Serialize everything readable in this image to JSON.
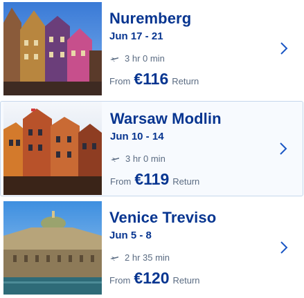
{
  "colors": {
    "accent": "#073590",
    "muted_text": "#5a6b82",
    "chevron": "#1a56c4",
    "selected_border": "#c6d7ec"
  },
  "destinations": [
    {
      "city": "Nuremberg",
      "dates": "Jun 17 - 21",
      "duration": "3 hr 0 min",
      "from_label": "From",
      "price": "€116",
      "trip_type": "Return",
      "icon": "plane-icon"
    },
    {
      "city": "Warsaw Modlin",
      "dates": "Jun 10 - 14",
      "duration": "3 hr 0 min",
      "from_label": "From",
      "price": "€119",
      "trip_type": "Return",
      "icon": "plane-icon"
    },
    {
      "city": "Venice Treviso",
      "dates": "Jun 5 - 8",
      "duration": "2 hr 35 min",
      "from_label": "From",
      "price": "€120",
      "trip_type": "Return",
      "icon": "plane-icon"
    }
  ]
}
